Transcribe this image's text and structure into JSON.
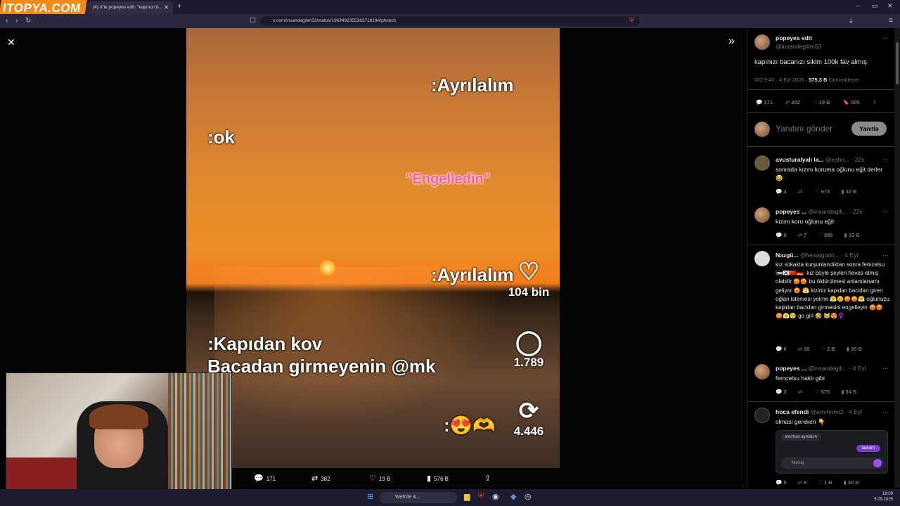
{
  "browser": {
    "logo_text": "ITOPYA.COM",
    "tab_title": "(4) X'te popeyes edit: \"kapınızı b...",
    "url": "x.com/insandegilim53/status/1963492355383718184/photo/1",
    "new_tab": "+",
    "win_min": "–",
    "win_max": "▭",
    "win_close": "✕"
  },
  "viewer": {
    "close_icon": "✕",
    "expand_icon": "»"
  },
  "photo": {
    "overlay_ok": ":ok",
    "overlay_ayrilalim_top": ":Ayrılalım",
    "overlay_engelledin": "\"Engelledin\"",
    "overlay_ayrilalim_mid": ":Ayrılalım",
    "overlay_kapidan": ":Kapıdan kov",
    "overlay_bacadan": "Bacadan girmeyenin @mk",
    "overlay_emoji": ":😍🫶",
    "likes": "104 bin",
    "comments": "1.789",
    "reposts": "4.446"
  },
  "actionbar": {
    "replies": "171",
    "reposts": "382",
    "likes": "19 B",
    "views": "576 B"
  },
  "post": {
    "author": "popeyes edit",
    "handle": "@insandegilim53",
    "text": "kapınızı bacanızı sikim 100k fav almış",
    "time": "ÖÖ 9:40 · 4 Eyl 2025 · ",
    "views_count": "575,3 B",
    "views_label": " Görüntüleme",
    "replies": "171",
    "reposts": "382",
    "likes": "19 B",
    "bookmarks": "605",
    "reply_placeholder": "Yanıtını gönder",
    "reply_button": "Yanıtla"
  },
  "replies": [
    {
      "name": "avusturalyalı la...",
      "handle": "@vaho...",
      "time": "· 22s",
      "text": "sonrada kızını koruma oğlunu eğit derler 😂",
      "r": "4",
      "rt": "",
      "l": "673",
      "v": "32 B"
    },
    {
      "name": "popeyes ...",
      "handle": "@insandegili...",
      "time": "· 22s",
      "text": "kızını koru oğlunu eğit",
      "r": "9",
      "rt": "7",
      "l": "996",
      "v": "33 B"
    },
    {
      "name": "Nazgü...",
      "handle": "@fersatgodo...",
      "time": "· 4 Eyl",
      "text": "kız sokakta kurşunlandıktan sonra femcelsu 🇵🇸🇰🇷🇨🇳🇩🇪: kız böyle şeyleri heves etmiş olabilir 😡😡 bu öldürülmesi anlamlanamı geliyor 😡 😤 kiziniz kapidan bacidan giren oğlan istemesi yeirne 😤😢😡😡😤 oğlunuzu kapidan bacidan girmesini engelleyin 😡😡😡😤🥺 go girl 🤣 😹😍♀️",
      "r": "8",
      "rt": "38",
      "l": "2 B",
      "v": "36 B"
    },
    {
      "name": "popeyes ...",
      "handle": "@insandegili...",
      "time": "· 4 Eyl",
      "text": "femcelsu haklı gibi",
      "r": "3",
      "rt": "",
      "l": "575",
      "v": "34 B"
    },
    {
      "name": "hoca efendi",
      "handle": "@emrhnnn2",
      "time": "· 4 Eyl",
      "text": "olmasi gereken 👇",
      "r": "5",
      "rt": "6",
      "l": "1 B",
      "v": "30 B"
    }
  ],
  "embedded": {
    "chat_title": "emirhan ayrılalım",
    "bubble": "tamam",
    "input_placeholder": "Mesaj"
  },
  "taskbar": {
    "search": "Web'de &...",
    "time": "18:09",
    "date": "5.09.2025"
  }
}
